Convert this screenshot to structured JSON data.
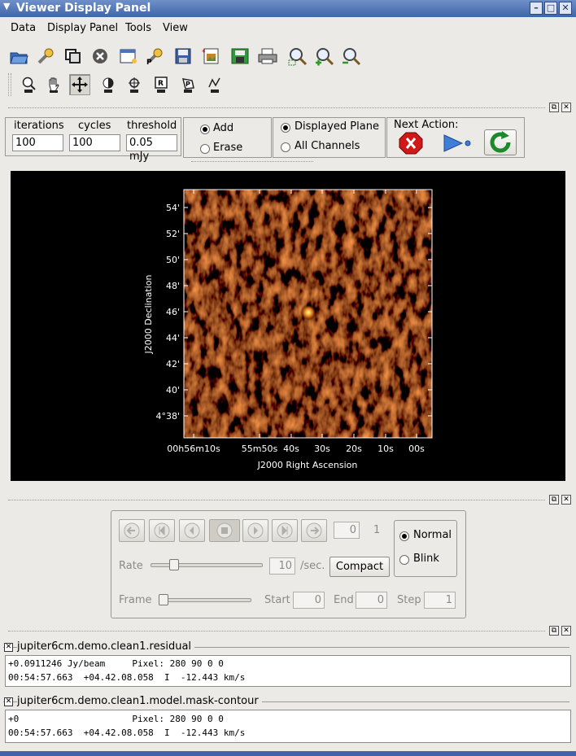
{
  "window": {
    "title": "Viewer Display Panel"
  },
  "menubar": {
    "items": [
      "Data",
      "Display Panel",
      "Tools",
      "View"
    ]
  },
  "toolbar": {
    "icons": [
      "open-folder-icon",
      "wrench-icon",
      "copy-panel-icon",
      "close-icon",
      "new-panel-icon",
      "print-setup-icon",
      "save-icon",
      "export-image-icon",
      "save-restore-icon",
      "print-icon",
      "zoom-fit-icon",
      "zoom-in-icon",
      "zoom-out-icon"
    ]
  },
  "mouse_tools": {
    "icons": [
      "zoom-tool-icon",
      "pan-tool-icon",
      "move-tool-icon",
      "contrast-tool-icon",
      "point-tool-icon",
      "rectangle-tool-icon",
      "polygon-tool-icon",
      "polyline-tool-icon"
    ],
    "active_index": 2
  },
  "clean": {
    "iterations_label": "iterations",
    "cycles_label": "cycles",
    "threshold_label": "threshold",
    "iterations": "100",
    "cycles": "100",
    "threshold": "0.05 mJy",
    "add_label": "Add",
    "erase_label": "Erase",
    "mask_mode": "Add",
    "displayed_plane_label": "Displayed Plane",
    "all_channels_label": "All Channels",
    "plane_mode": "Displayed Plane",
    "next_action_label": "Next Action:"
  },
  "plot": {
    "y_axis_label": "J2000 Declination",
    "x_axis_label": "J2000 Right Ascension",
    "y_ticks": [
      "54'",
      "52'",
      "50'",
      "48'",
      "46'",
      "44'",
      "42'",
      "40'",
      "4°38'"
    ],
    "x_ticks": [
      "00h56m10s",
      "55m50s",
      "40s",
      "30s",
      "20s",
      "10s",
      "00s"
    ]
  },
  "animator": {
    "frame_value": "0",
    "frame_count": "1",
    "rate_label": "Rate",
    "rate_value": "10",
    "rate_unit": "/sec.",
    "compact_label": "Compact",
    "normal_label": "Normal",
    "blink_label": "Blink",
    "mode": "Normal",
    "frame_label": "Frame",
    "start_label": "Start",
    "start_value": "0",
    "end_label": "End",
    "end_value": "0",
    "step_label": "Step",
    "step_value": "1"
  },
  "tracking": [
    {
      "name": "jupiter6cm.demo.clean1.residual",
      "line1": "+0.0911246 Jy/beam     Pixel: 280 90 0 0",
      "line2": "00:54:57.663  +04.42.08.058  I  -12.443 km/s"
    },
    {
      "name": "jupiter6cm.demo.clean1.model.mask-contour",
      "line1": "+0                     Pixel: 280 90 0 0",
      "line2": "00:54:57.663  +04.42.08.058  I  -12.443 km/s"
    }
  ],
  "colors": {
    "titlebar": "#3f64a9",
    "background": "#eceae6",
    "image_hot": "#ffe9a0",
    "image_mid": "#a04a10"
  }
}
